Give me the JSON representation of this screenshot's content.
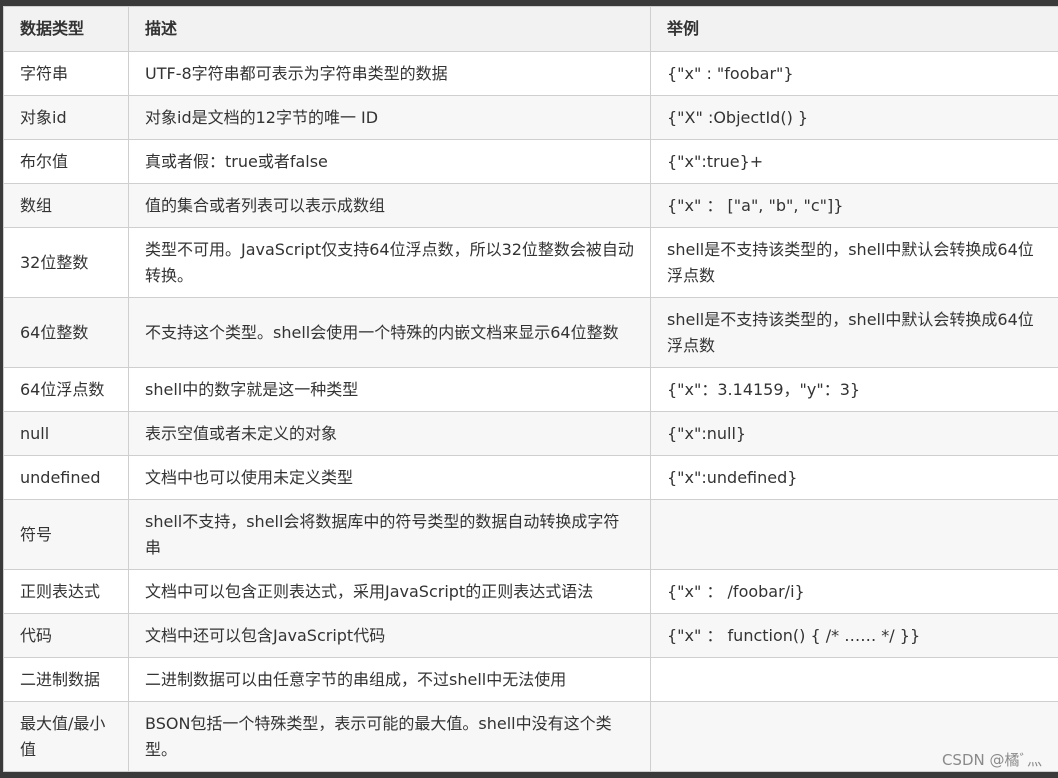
{
  "headers": [
    "数据类型",
    "描述",
    "举例"
  ],
  "rows": [
    [
      "字符串",
      "UTF-8字符串都可表示为字符串类型的数据",
      "{\"x\" : \"foobar\"}"
    ],
    [
      "对象id",
      "对象id是文档的12字节的唯一 ID",
      "{\"X\" :ObjectId() }"
    ],
    [
      "布尔值",
      "真或者假：true或者false",
      "{\"x\":true}+"
    ],
    [
      "数组",
      "值的集合或者列表可以表示成数组",
      "{\"x\" ： [\"a\", \"b\", \"c\"]}"
    ],
    [
      "32位整数",
      "类型不可用。JavaScript仅支持64位浮点数，所以32位整数会被自动转换。",
      "shell是不支持该类型的，shell中默认会转换成64位浮点数"
    ],
    [
      "64位整数",
      "不支持这个类型。shell会使用一个特殊的内嵌文档来显示64位整数",
      "shell是不支持该类型的，shell中默认会转换成64位浮点数"
    ],
    [
      "64位浮点数",
      "shell中的数字就是这一种类型",
      "{\"x\"：3.14159，\"y\"：3}"
    ],
    [
      "null",
      "表示空值或者未定义的对象",
      "{\"x\":null}"
    ],
    [
      "undefined",
      "文档中也可以使用未定义类型",
      "{\"x\":undefined}"
    ],
    [
      "符号",
      "shell不支持，shell会将数据库中的符号类型的数据自动转换成字符串",
      ""
    ],
    [
      "正则表达式",
      "文档中可以包含正则表达式，采用JavaScript的正则表达式语法",
      "{\"x\" ： /foobar/i}"
    ],
    [
      "代码",
      "文档中还可以包含JavaScript代码",
      "{\"x\" ： function() { /* …… */ }}"
    ],
    [
      "二进制数据",
      "二进制数据可以由任意字节的串组成，不过shell中无法使用",
      ""
    ],
    [
      "最大值/最小值",
      "BSON包括一个特殊类型，表示可能的最大值。shell中没有这个类型。",
      ""
    ]
  ],
  "watermark": "CSDN @橘ﾞ灬"
}
